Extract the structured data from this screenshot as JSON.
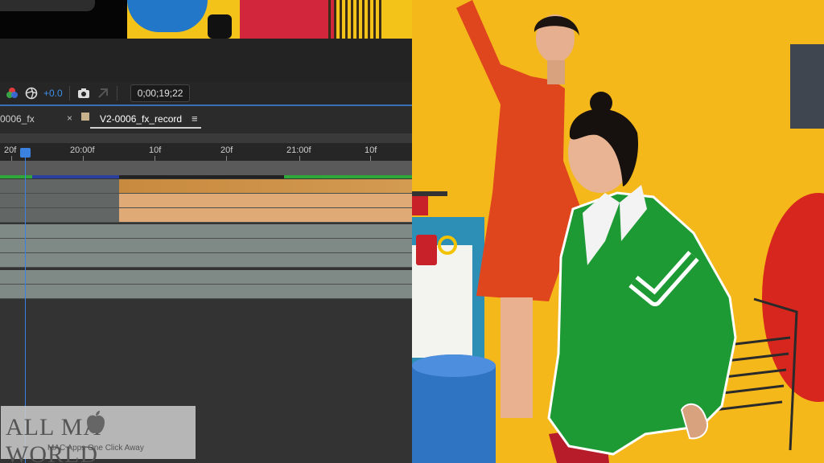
{
  "toolbar": {
    "exposure_value": "+0.0",
    "timecode": "0;00;19;22"
  },
  "tabs": [
    {
      "label": "0006_fx"
    },
    {
      "close": "×",
      "label": "V2-0006_fx_record",
      "menu": "≡"
    }
  ],
  "ruler": {
    "labels": [
      "20f",
      "20:00f",
      "10f",
      "20f",
      "21:00f",
      "10f"
    ]
  },
  "playhead": {
    "frame_label": "20f"
  },
  "watermark": {
    "title_left": "ALL MA",
    "title_right": " WORLD",
    "subtitle": "MAC Apps One Click Away"
  },
  "icons": {
    "color-channels": "color-channels-icon",
    "exposure": "exposure-icon",
    "snapshot": "camera-icon",
    "show-snapshot": "show-snapshot-icon"
  },
  "colors": {
    "accent": "#3b82e0",
    "clip_orange": "#c88a3e",
    "clip_tan": "#dfaa76",
    "track_gray": "#7f8a86",
    "work_green": "#2fa83a",
    "video_yellow": "#f5b81a",
    "jacket_green": "#1e9a35",
    "dress_orange": "#e0461e"
  }
}
